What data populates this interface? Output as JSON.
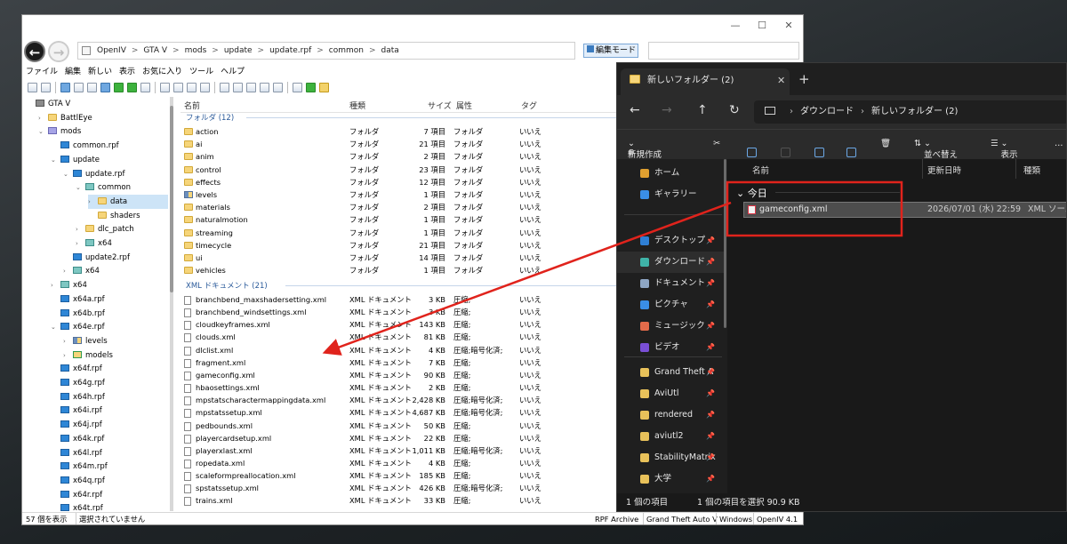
{
  "openiv": {
    "title_controls": {
      "minimize": "—",
      "maximize": "☐",
      "close": "✕"
    },
    "breadcrumb": [
      "OpenIV",
      "GTA V",
      "mods",
      "update",
      "update.rpf",
      "common",
      "data"
    ],
    "breadcrumb_sep": ">",
    "edit_mode_label": "編集モード",
    "menu": [
      "ファイル",
      "編集",
      "新しい",
      "表示",
      "お気に入り",
      "ツール",
      "ヘルプ"
    ],
    "tree": [
      {
        "label": "GTA V",
        "icon": "gtav-icon",
        "indent": 0,
        "toggle": ""
      },
      {
        "label": "BattlEye",
        "icon": "folder",
        "indent": 1,
        "toggle": "›"
      },
      {
        "label": "mods",
        "icon": "purple",
        "indent": 1,
        "toggle": "⌄"
      },
      {
        "label": "common.rpf",
        "icon": "rpf",
        "indent": 2,
        "toggle": ""
      },
      {
        "label": "update",
        "icon": "rpf",
        "indent": 2,
        "toggle": "⌄"
      },
      {
        "label": "update.rpf",
        "icon": "rpf",
        "indent": 3,
        "toggle": "⌄"
      },
      {
        "label": "common",
        "icon": "cyan",
        "indent": 4,
        "toggle": "⌄"
      },
      {
        "label": "data",
        "icon": "folder",
        "indent": 5,
        "toggle": "›",
        "selected": true
      },
      {
        "label": "shaders",
        "icon": "folder",
        "indent": 5,
        "toggle": ""
      },
      {
        "label": "dlc_patch",
        "icon": "folder",
        "indent": 4,
        "toggle": "›"
      },
      {
        "label": "x64",
        "icon": "cyan",
        "indent": 4,
        "toggle": "›"
      },
      {
        "label": "update2.rpf",
        "icon": "rpf",
        "indent": 3,
        "toggle": ""
      },
      {
        "label": "x64",
        "icon": "cyan",
        "indent": 3,
        "toggle": "›"
      },
      {
        "label": "x64",
        "icon": "cyan",
        "indent": 2,
        "toggle": "›"
      },
      {
        "label": "x64a.rpf",
        "icon": "rpf",
        "indent": 2,
        "toggle": ""
      },
      {
        "label": "x64b.rpf",
        "icon": "rpf",
        "indent": 2,
        "toggle": ""
      },
      {
        "label": "x64e.rpf",
        "icon": "rpf",
        "indent": 2,
        "toggle": "⌄"
      },
      {
        "label": "levels",
        "icon": "levels",
        "indent": 3,
        "toggle": "›"
      },
      {
        "label": "models",
        "icon": "models",
        "indent": 3,
        "toggle": "›"
      },
      {
        "label": "x64f.rpf",
        "icon": "rpf",
        "indent": 2,
        "toggle": ""
      },
      {
        "label": "x64g.rpf",
        "icon": "rpf",
        "indent": 2,
        "toggle": ""
      },
      {
        "label": "x64h.rpf",
        "icon": "rpf",
        "indent": 2,
        "toggle": ""
      },
      {
        "label": "x64i.rpf",
        "icon": "rpf",
        "indent": 2,
        "toggle": ""
      },
      {
        "label": "x64j.rpf",
        "icon": "rpf",
        "indent": 2,
        "toggle": ""
      },
      {
        "label": "x64k.rpf",
        "icon": "rpf",
        "indent": 2,
        "toggle": ""
      },
      {
        "label": "x64l.rpf",
        "icon": "rpf",
        "indent": 2,
        "toggle": ""
      },
      {
        "label": "x64m.rpf",
        "icon": "rpf",
        "indent": 2,
        "toggle": ""
      },
      {
        "label": "x64q.rpf",
        "icon": "rpf",
        "indent": 2,
        "toggle": ""
      },
      {
        "label": "x64r.rpf",
        "icon": "rpf",
        "indent": 2,
        "toggle": ""
      },
      {
        "label": "x64t.rpf",
        "icon": "rpf",
        "indent": 2,
        "toggle": ""
      }
    ],
    "columns": {
      "name": "名前",
      "type": "種類",
      "size": "サイズ",
      "attr": "属性",
      "tag": "タグ"
    },
    "folder_group": "フォルダ (12)",
    "folders": [
      {
        "name": "action",
        "type": "フォルダ",
        "size": "7 項目",
        "attr": "フォルダ",
        "tag": "いいえ"
      },
      {
        "name": "ai",
        "type": "フォルダ",
        "size": "21 項目",
        "attr": "フォルダ",
        "tag": "いいえ"
      },
      {
        "name": "anim",
        "type": "フォルダ",
        "size": "2 項目",
        "attr": "フォルダ",
        "tag": "いいえ"
      },
      {
        "name": "control",
        "type": "フォルダ",
        "size": "23 項目",
        "attr": "フォルダ",
        "tag": "いいえ"
      },
      {
        "name": "effects",
        "type": "フォルダ",
        "size": "12 項目",
        "attr": "フォルダ",
        "tag": "いいえ"
      },
      {
        "name": "levels",
        "type": "フォルダ",
        "size": "1 項目",
        "attr": "フォルダ",
        "tag": "いいえ"
      },
      {
        "name": "materials",
        "type": "フォルダ",
        "size": "2 項目",
        "attr": "フォルダ",
        "tag": "いいえ"
      },
      {
        "name": "naturalmotion",
        "type": "フォルダ",
        "size": "1 項目",
        "attr": "フォルダ",
        "tag": "いいえ"
      },
      {
        "name": "streaming",
        "type": "フォルダ",
        "size": "1 項目",
        "attr": "フォルダ",
        "tag": "いいえ"
      },
      {
        "name": "timecycle",
        "type": "フォルダ",
        "size": "21 項目",
        "attr": "フォルダ",
        "tag": "いいえ"
      },
      {
        "name": "ui",
        "type": "フォルダ",
        "size": "14 項目",
        "attr": "フォルダ",
        "tag": "いいえ"
      },
      {
        "name": "vehicles",
        "type": "フォルダ",
        "size": "1 項目",
        "attr": "フォルダ",
        "tag": "いいえ"
      }
    ],
    "xml_group": "XML ドキュメント (21)",
    "xml_files": [
      {
        "name": "branchbend_maxshadersetting.xml",
        "type": "XML ドキュメント",
        "size": "3 KB",
        "attr": "圧縮;",
        "tag": "いいえ"
      },
      {
        "name": "branchbend_windsettings.xml",
        "type": "XML ドキュメント",
        "size": "3 KB",
        "attr": "圧縮;",
        "tag": "いいえ"
      },
      {
        "name": "cloudkeyframes.xml",
        "type": "XML ドキュメント",
        "size": "143 KB",
        "attr": "圧縮;",
        "tag": "いいえ"
      },
      {
        "name": "clouds.xml",
        "type": "XML ドキュメント",
        "size": "81 KB",
        "attr": "圧縮;",
        "tag": "いいえ"
      },
      {
        "name": "dlclist.xml",
        "type": "XML ドキュメント",
        "size": "4 KB",
        "attr": "圧縮;暗号化済;",
        "tag": "いいえ"
      },
      {
        "name": "fragment.xml",
        "type": "XML ドキュメント",
        "size": "7 KB",
        "attr": "圧縮;",
        "tag": "いいえ"
      },
      {
        "name": "gameconfig.xml",
        "type": "XML ドキュメント",
        "size": "90 KB",
        "attr": "圧縮;",
        "tag": "いいえ"
      },
      {
        "name": "hbaosettings.xml",
        "type": "XML ドキュメント",
        "size": "2 KB",
        "attr": "圧縮;",
        "tag": "いいえ"
      },
      {
        "name": "mpstatscharactermappingdata.xml",
        "type": "XML ドキュメント",
        "size": "2,428 KB",
        "attr": "圧縮;暗号化済;",
        "tag": "いいえ"
      },
      {
        "name": "mpstatssetup.xml",
        "type": "XML ドキュメント",
        "size": "4,687 KB",
        "attr": "圧縮;暗号化済;",
        "tag": "いいえ"
      },
      {
        "name": "pedbounds.xml",
        "type": "XML ドキュメント",
        "size": "50 KB",
        "attr": "圧縮;",
        "tag": "いいえ"
      },
      {
        "name": "playercardsetup.xml",
        "type": "XML ドキュメント",
        "size": "22 KB",
        "attr": "圧縮;",
        "tag": "いいえ"
      },
      {
        "name": "playerxlast.xml",
        "type": "XML ドキュメント",
        "size": "1,011 KB",
        "attr": "圧縮;暗号化済;",
        "tag": "いいえ"
      },
      {
        "name": "ropedata.xml",
        "type": "XML ドキュメント",
        "size": "4 KB",
        "attr": "圧縮;",
        "tag": "いいえ"
      },
      {
        "name": "scaleformpreallocation.xml",
        "type": "XML ドキュメント",
        "size": "185 KB",
        "attr": "圧縮;",
        "tag": "いいえ"
      },
      {
        "name": "spstatssetup.xml",
        "type": "XML ドキュメント",
        "size": "426 KB",
        "attr": "圧縮;暗号化済;",
        "tag": "いいえ"
      },
      {
        "name": "trains.xml",
        "type": "XML ドキュメント",
        "size": "33 KB",
        "attr": "圧縮;",
        "tag": "いいえ"
      }
    ],
    "status": {
      "count": "57 個を表示",
      "selection": "選択されていません",
      "archive": "RPF Archive",
      "game": "Grand Theft Auto V",
      "platform": "Windows",
      "version": "OpenIV 4.1"
    }
  },
  "explorer": {
    "tab_title": "新しいフォルダー (2)",
    "tab_close": "✕",
    "new_tab": "+",
    "nav": {
      "back": "←",
      "forward": "→",
      "up": "↑",
      "refresh": "↻"
    },
    "breadcrumb": [
      "ダウンロード",
      "新しいフォルダー (2)"
    ],
    "commands": {
      "new": "新規作成",
      "sort": "並べ替え",
      "view": "表示",
      "more": "…"
    },
    "sidebar": [
      {
        "label": "ホーム",
        "color": "#e0a030",
        "pinned": false
      },
      {
        "label": "ギャラリー",
        "color": "#3a8ee6",
        "pinned": false
      },
      {
        "label": "デスクトップ",
        "color": "#2f7fd4",
        "pinned": true
      },
      {
        "label": "ダウンロード",
        "color": "#3fb3a8",
        "pinned": true,
        "selected": true
      },
      {
        "label": "ドキュメント",
        "color": "#8ea6c4",
        "pinned": true
      },
      {
        "label": "ピクチャ",
        "color": "#3a8ee6",
        "pinned": true
      },
      {
        "label": "ミュージック",
        "color": "#e36b4a",
        "pinned": true
      },
      {
        "label": "ビデオ",
        "color": "#7a4fd6",
        "pinned": true
      },
      {
        "label": "Grand Theft A",
        "color": "#e8c15a",
        "pinned": true
      },
      {
        "label": "AviUtl",
        "color": "#e8c15a",
        "pinned": true
      },
      {
        "label": "rendered",
        "color": "#e8c15a",
        "pinned": true
      },
      {
        "label": "aviutl2",
        "color": "#e8c15a",
        "pinned": true
      },
      {
        "label": "StabilityMatrix",
        "color": "#e8c15a",
        "pinned": true
      },
      {
        "label": "大学",
        "color": "#e8c15a",
        "pinned": true
      }
    ],
    "pin_glyph": "📌",
    "columns": {
      "name": "名前",
      "date": "更新日時",
      "type": "種類"
    },
    "group": "今日",
    "file": {
      "name": "gameconfig.xml",
      "date": "2026/07/01 (水) 22:59",
      "type": "XML ソース"
    },
    "status": {
      "items": "1 個の項目",
      "selected": "1 個の項目を選択  90.9 KB"
    }
  },
  "annotation": {
    "color": "#e0231c"
  }
}
